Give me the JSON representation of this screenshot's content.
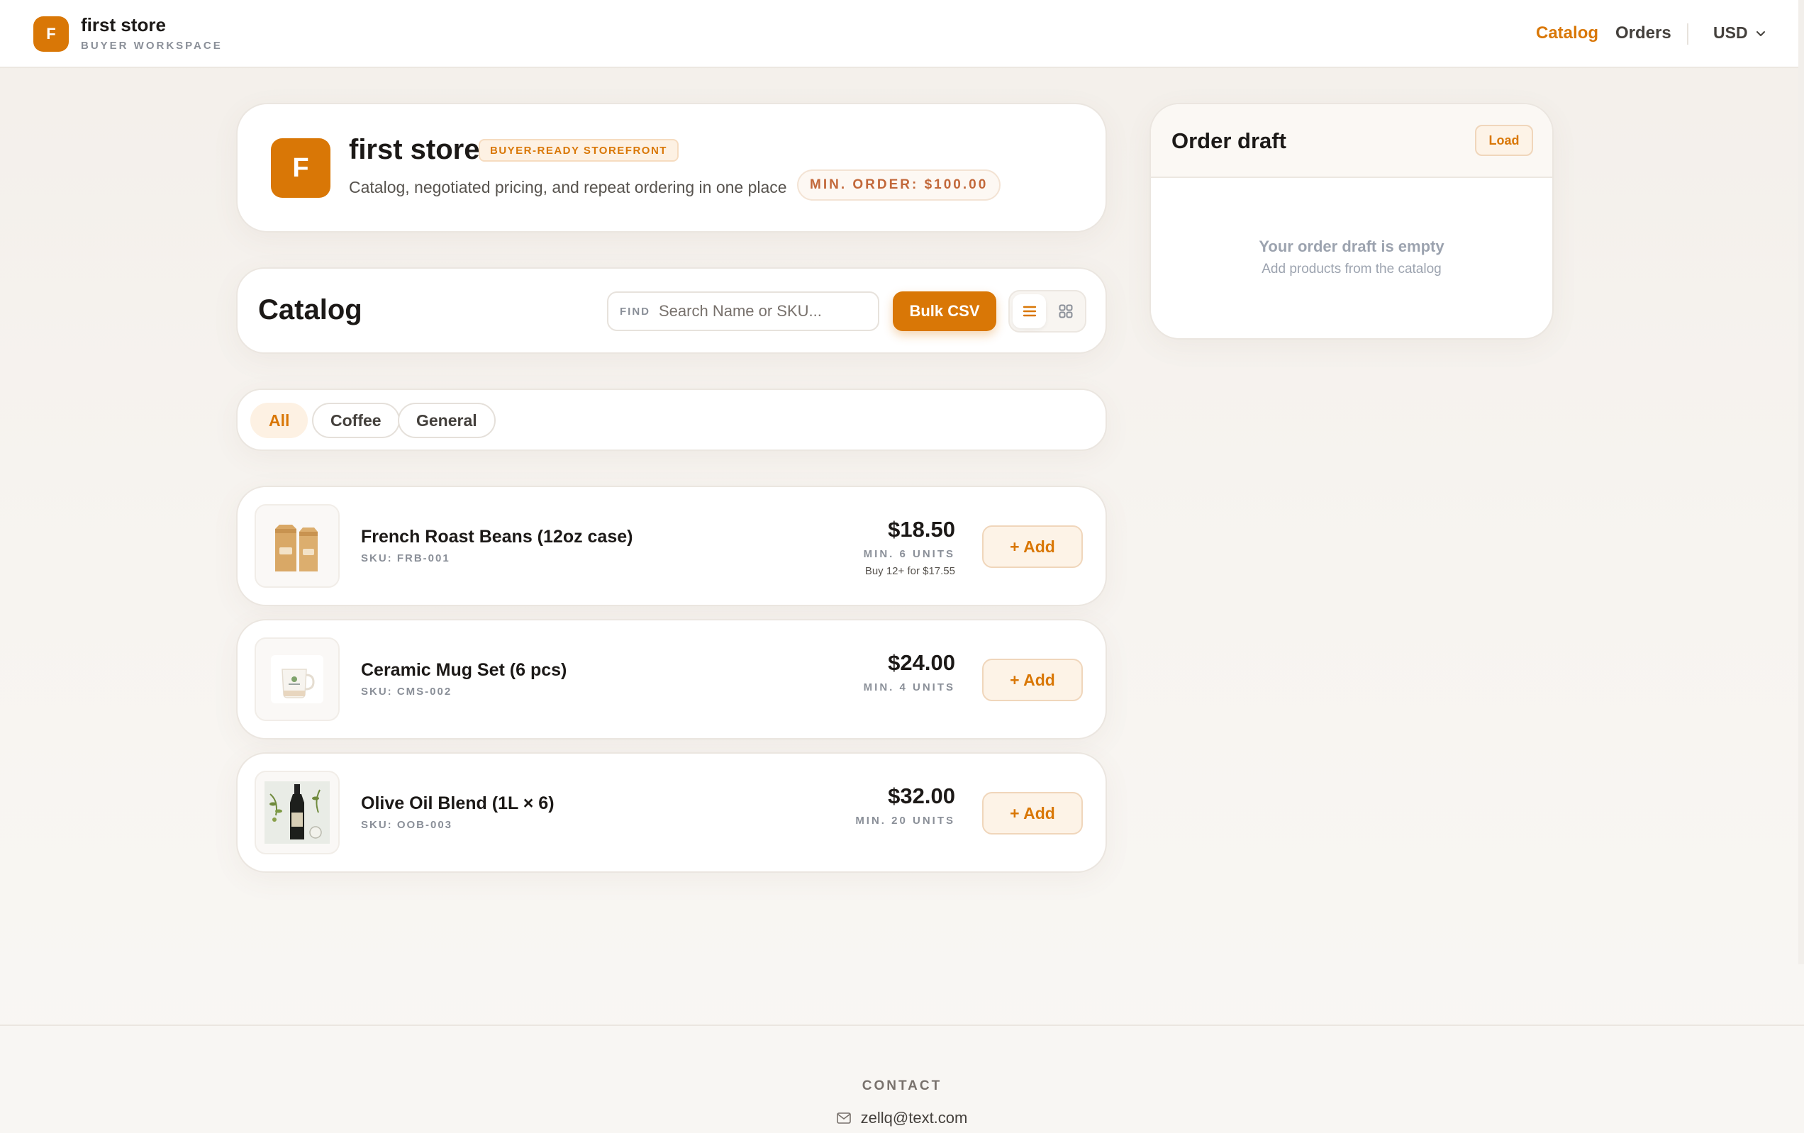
{
  "header": {
    "badge_letter": "F",
    "store_name": "first store",
    "workspace_label": "BUYER WORKSPACE",
    "nav": {
      "catalog": "Catalog",
      "orders": "Orders",
      "currency": "USD"
    }
  },
  "store": {
    "logo_letter": "F",
    "title": "first store",
    "tag": "BUYER-READY STOREFRONT",
    "description": "Catalog, negotiated pricing, and repeat ordering in one place",
    "min_order": "MIN. ORDER: $100.00"
  },
  "catalog": {
    "title": "Catalog",
    "search_label": "FIND",
    "search_placeholder": "Search Name or SKU...",
    "search_value": "",
    "bulk_label": "Bulk CSV",
    "view_mode": "list"
  },
  "filters": [
    {
      "label": "All",
      "active": true
    },
    {
      "label": "Coffee",
      "active": false
    },
    {
      "label": "General",
      "active": false
    }
  ],
  "products": [
    {
      "name": "French Roast Beans (12oz case)",
      "sku": "SKU: FRB-001",
      "price": "$18.50",
      "min": "MIN. 6 UNITS",
      "tier": "Buy 12+ for $17.55",
      "add_label": "+ Add",
      "image_icon": "coffee-bag-icon"
    },
    {
      "name": "Ceramic Mug Set (6 pcs)",
      "sku": "SKU: CMS-002",
      "price": "$24.00",
      "min": "MIN. 4 UNITS",
      "tier": "",
      "add_label": "+ Add",
      "image_icon": "mug-icon"
    },
    {
      "name": "Olive Oil Blend (1L × 6)",
      "sku": "SKU: OOB-003",
      "price": "$32.00",
      "min": "MIN. 20 UNITS",
      "tier": "",
      "add_label": "+ Add",
      "image_icon": "olive-oil-bottle-icon"
    }
  ],
  "draft": {
    "title": "Order draft",
    "load_label": "Load",
    "empty_title": "Your order draft is empty",
    "empty_hint": "Add products from the catalog"
  },
  "footer": {
    "label": "CONTACT",
    "email": "zellq@text.com",
    "email_icon": "mail-icon"
  },
  "colors": {
    "accent": "#d97706",
    "accent_soft": "#fdf1e3",
    "text": "#1c1917",
    "muted": "#8a8f98"
  }
}
